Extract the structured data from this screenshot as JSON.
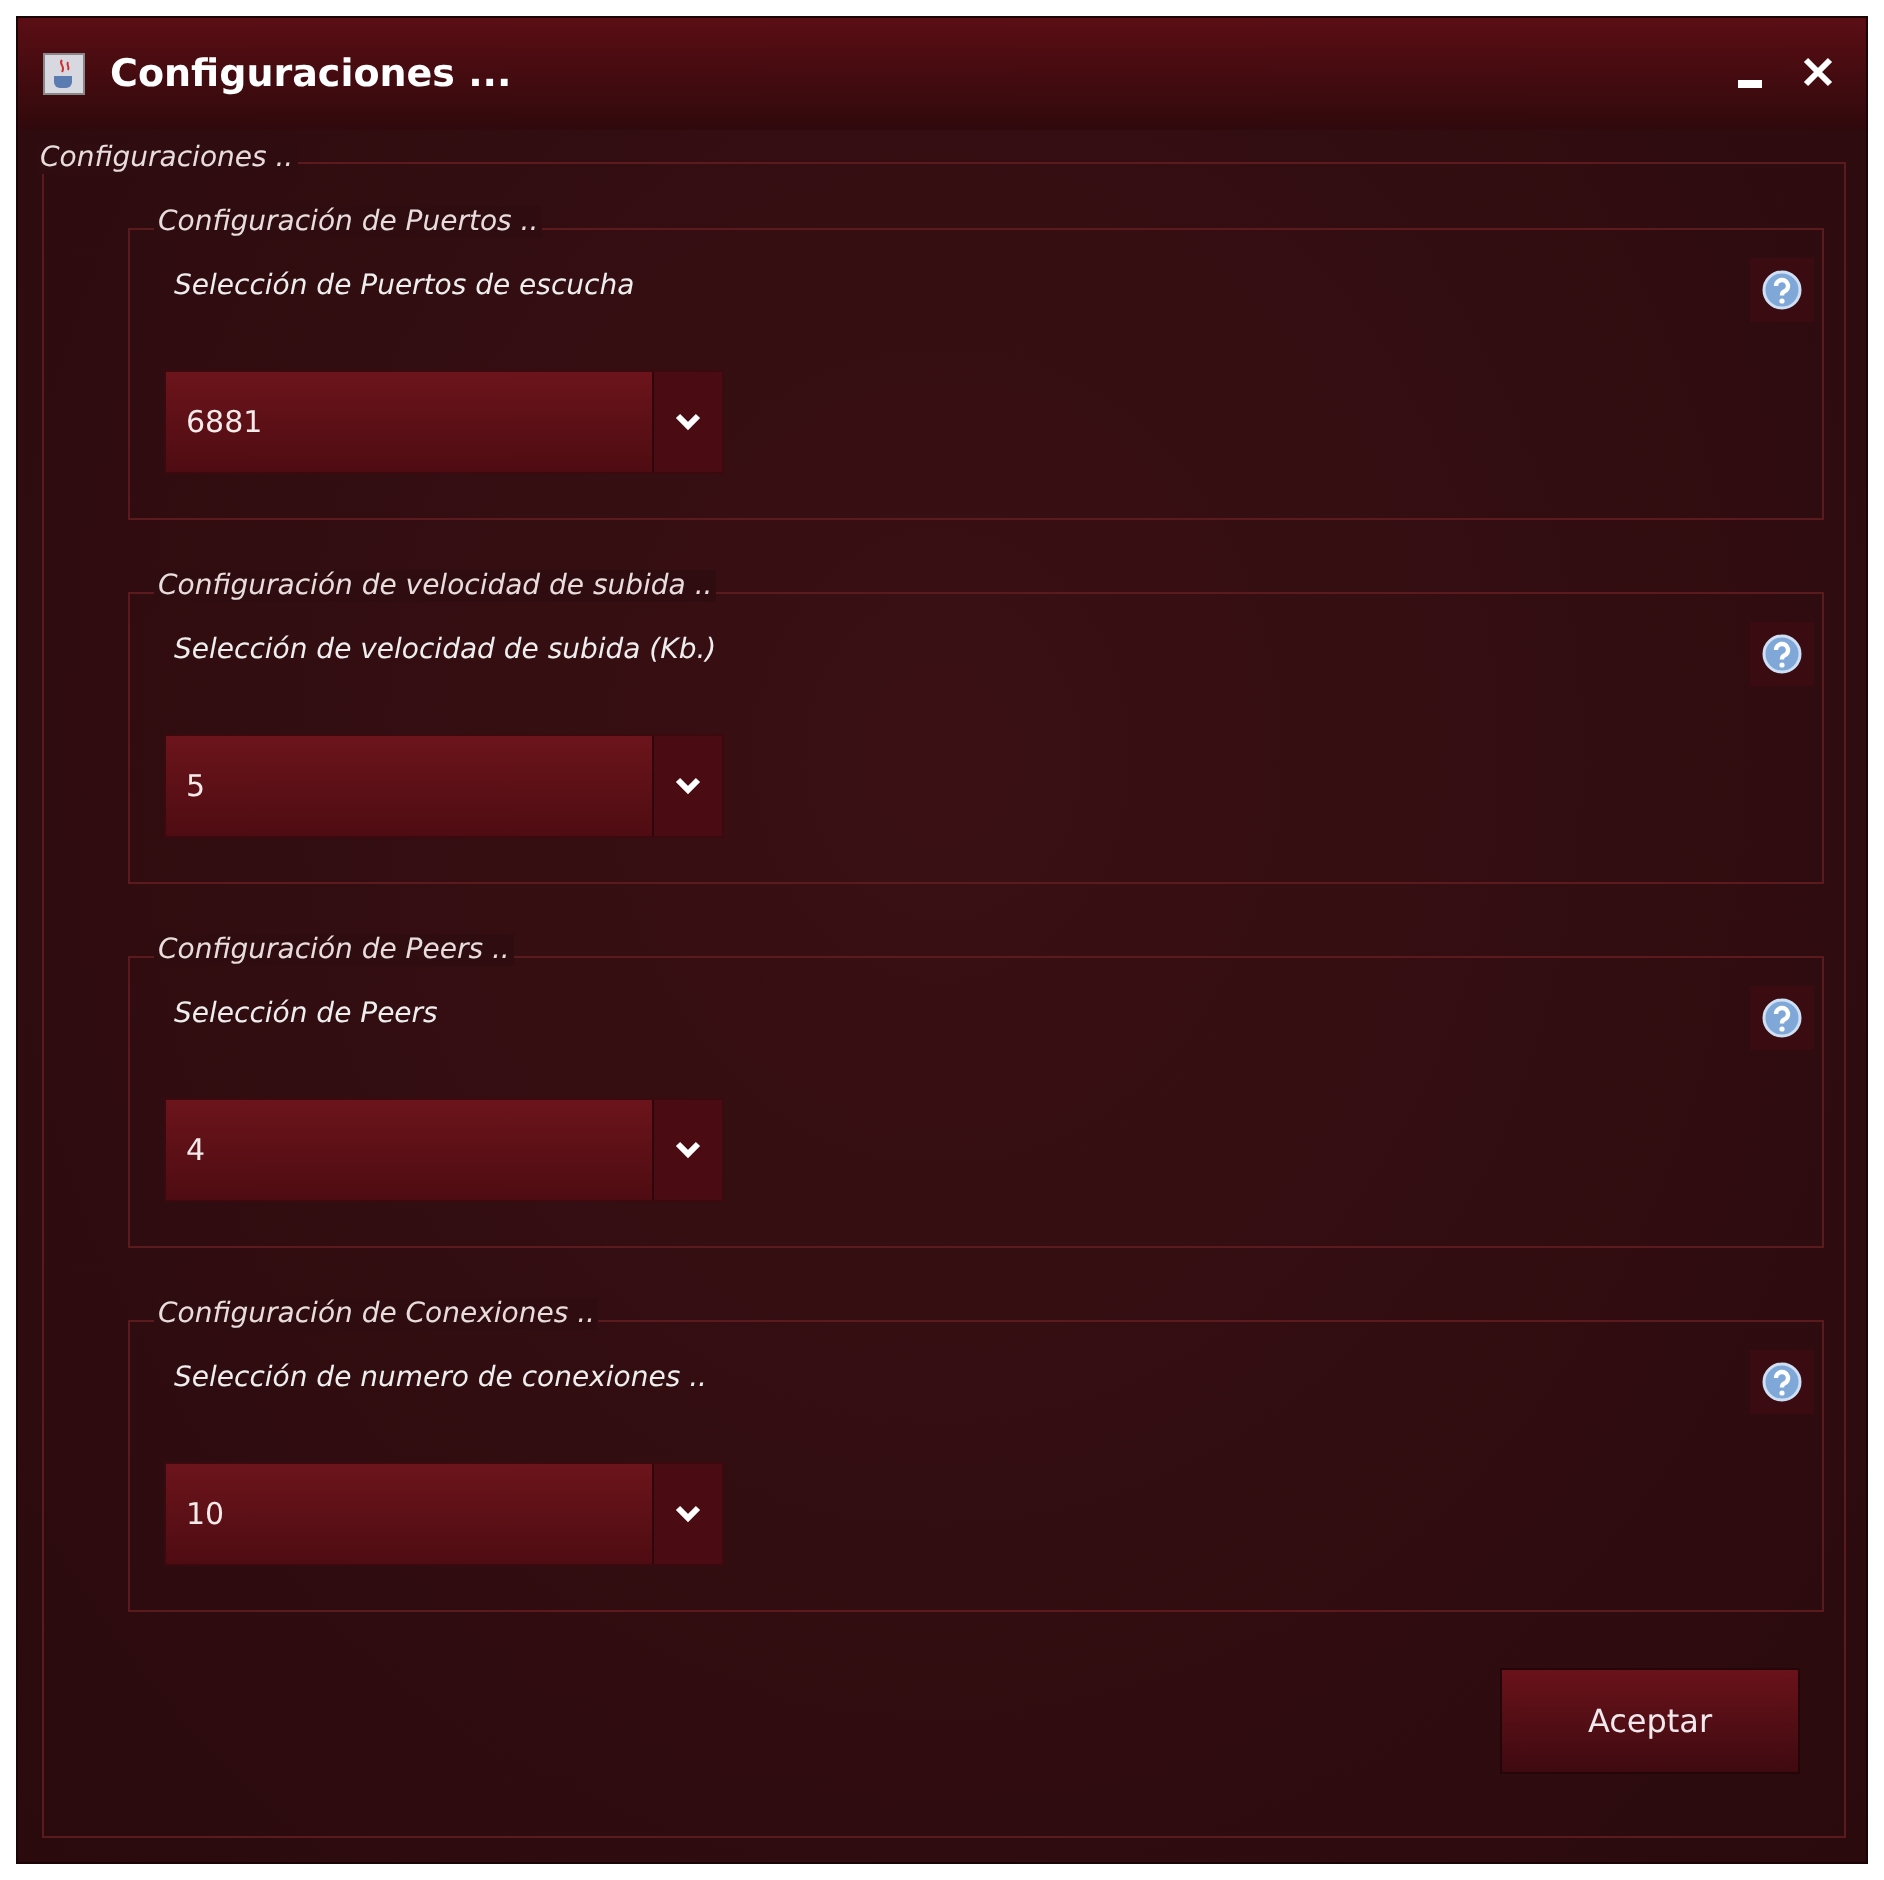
{
  "window": {
    "title": "Configuraciones ..."
  },
  "group": {
    "title": "Configuraciones .."
  },
  "sections": [
    {
      "title": "Configuración de Puertos ..",
      "label": "Selección de Puertos de escucha",
      "value": "6881"
    },
    {
      "title": "Configuración de velocidad de subida ..",
      "label": "Selección de velocidad de subida (Kb.)",
      "value": "5"
    },
    {
      "title": "Configuración de Peers ..",
      "label": "Selección de Peers",
      "value": "4"
    },
    {
      "title": "Configuración de Conexiones ..",
      "label": "Selección de numero de conexiones ..",
      "value": "10"
    }
  ],
  "buttons": [
    "Aceptar"
  ]
}
